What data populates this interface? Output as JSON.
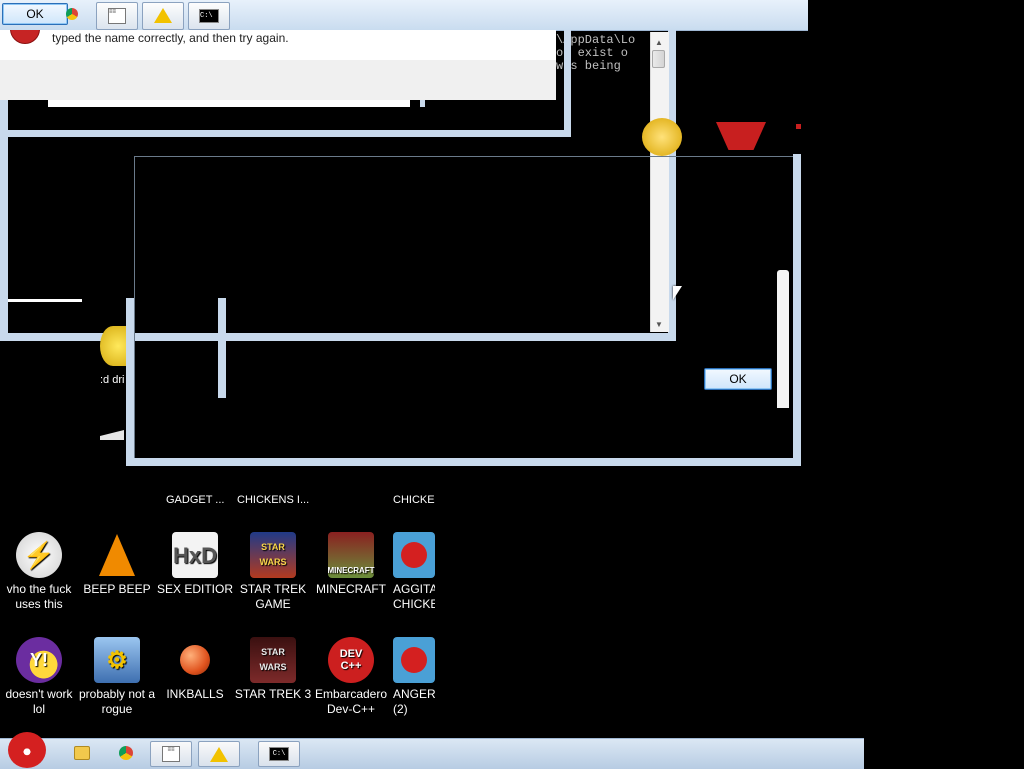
{
  "dialog": {
    "message": "typed the name correctly, and then try again.",
    "ok_label_top": "OK",
    "ok_label_mid": "OK"
  },
  "console": {
    "lines": [
      "\\AppData\\Lo",
      "ot exist o",
      "was being"
    ]
  },
  "desktop_partial_labels": {
    "gadget": "GADGET ...",
    "chickens": "CHICKENS I...",
    "chicke": "CHICKE",
    "cd_drive": ":d dri"
  },
  "desktop_icons_row1": [
    {
      "label": "vho the fuck uses this",
      "icon": "winamp-bolt-icon",
      "color": "#d9d9d9"
    },
    {
      "label": "BEEP BEEP",
      "icon": "vlc-cone-icon",
      "color": "#f08a00"
    },
    {
      "label": "SEX EDITIOR",
      "icon": "hxd-editor-icon",
      "color": "#9bc43c"
    },
    {
      "label": "STAR TREK GAME",
      "icon": "star-wars-icon",
      "color": "#3a66c8"
    },
    {
      "label": "MINECRAFT",
      "icon": "minecraft-icon",
      "color": "#6b8e3b"
    },
    {
      "label": "AGGITA CHICKE",
      "icon": "angry-birds-icon",
      "color": "#4aa0d6"
    }
  ],
  "desktop_icons_row2": [
    {
      "label": "doesn't work lol",
      "icon": "yahoo-messenger-icon",
      "color": "#6b2da0"
    },
    {
      "label": "probably not a rogue",
      "icon": "gear-monitor-icon",
      "color": "#4d87c7"
    },
    {
      "label": "INKBALLS",
      "icon": "inkball-icon",
      "color": "#e0531e"
    },
    {
      "label": "STAR TREK 3",
      "icon": "star-wars-icon",
      "color": "#7d2a2a"
    },
    {
      "label": "Embarcadero Dev-C++",
      "icon": "devcpp-icon",
      "color": "#cc1f1f"
    },
    {
      "label": "ANGER (2)",
      "icon": "angry-birds-icon",
      "color": "#4aa0d6"
    }
  ],
  "top_taskbar": {
    "items": [
      "chrome-icon",
      "notepad-icon",
      "warning-icon",
      "cmd-icon"
    ]
  },
  "taskbar": {
    "items": [
      "explorer-icon",
      "chrome-icon",
      "notepad-icon",
      "warning-icon",
      "cmd-icon"
    ]
  },
  "colors": {
    "frame": "#c8d9ec",
    "taskbar": "#b7cce3",
    "error_red": "#c62424"
  }
}
